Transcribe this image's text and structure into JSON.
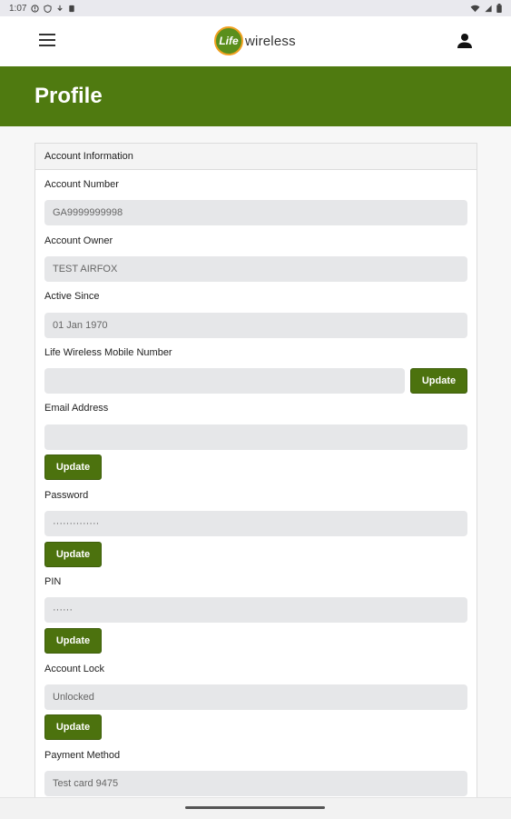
{
  "status_bar": {
    "time": "1:07",
    "left_icons": [
      "alert-circle-icon",
      "shield-icon",
      "download-icon",
      "sim-icon"
    ],
    "right_icons": [
      "wifi-icon",
      "signal-icon",
      "battery-icon"
    ]
  },
  "header": {
    "logo_mark": "Life",
    "logo_word": "wireless"
  },
  "page": {
    "title": "Profile"
  },
  "card": {
    "title": "Account Information"
  },
  "fields": {
    "account_number": {
      "label": "Account Number",
      "value": "GA9999999998"
    },
    "account_owner": {
      "label": "Account Owner",
      "value": "TEST AIRFOX"
    },
    "active_since": {
      "label": "Active Since",
      "value": "01 Jan 1970"
    },
    "mobile_number": {
      "label": "Life Wireless Mobile Number",
      "value": "",
      "button": "Update"
    },
    "email": {
      "label": "Email Address",
      "value": "",
      "button": "Update"
    },
    "password": {
      "label": "Password",
      "value": "··············",
      "button": "Update"
    },
    "pin": {
      "label": "PIN",
      "value": "······",
      "button": "Update"
    },
    "account_lock": {
      "label": "Account Lock",
      "value": "Unlocked",
      "button": "Update"
    },
    "payment_method": {
      "label": "Payment Method",
      "value": "Test card 9475"
    }
  },
  "colors": {
    "brand_green": "#4f7a10",
    "button_green": "#4c720e",
    "logo_orange": "#f0a020"
  }
}
